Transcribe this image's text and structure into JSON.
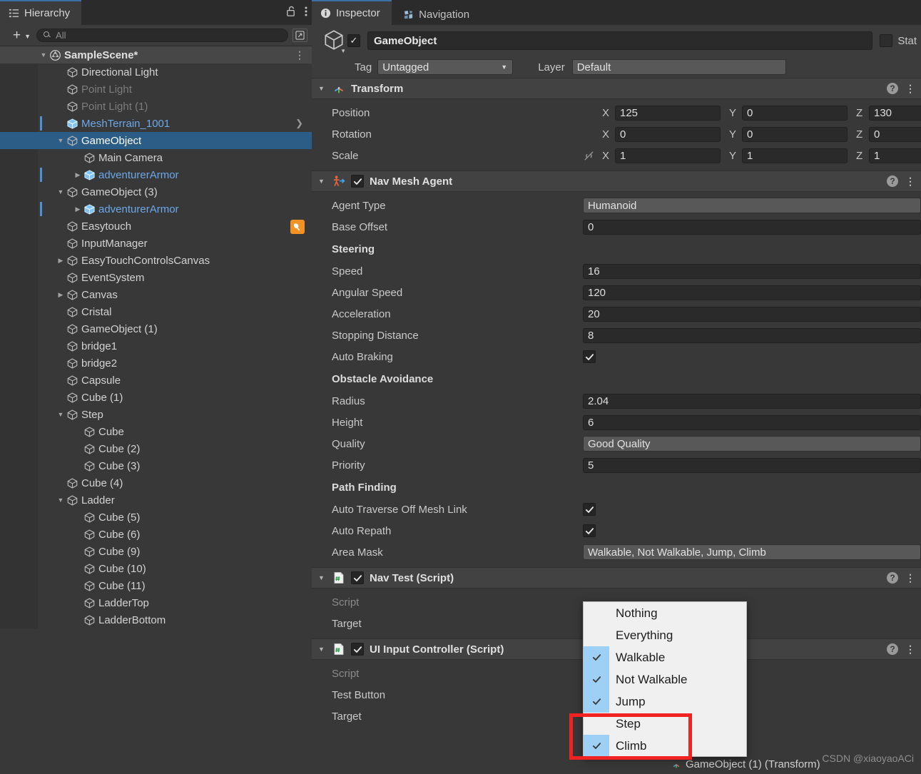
{
  "hierarchy": {
    "tab_label": "Hierarchy",
    "tab_icon": "hierarchy-icon",
    "lock_icon": "lock-open-icon",
    "menu_icon": "kebab-menu-icon",
    "add_label": "+",
    "search_placeholder": "All",
    "search_value": "",
    "expand_icon": "expand-window-icon",
    "items": [
      {
        "label": "SampleScene*",
        "depth": 0,
        "arrow": "down",
        "icon": "unity-scene-icon",
        "style": "scene",
        "menu": true
      },
      {
        "label": "Directional Light",
        "depth": 1,
        "arrow": "none",
        "icon": "gameobject-cube-icon",
        "style": "normal"
      },
      {
        "label": "Point Light",
        "depth": 1,
        "arrow": "none",
        "icon": "gameobject-cube-icon",
        "style": "dim"
      },
      {
        "label": "Point Light (1)",
        "depth": 1,
        "arrow": "none",
        "icon": "gameobject-cube-icon",
        "style": "dim"
      },
      {
        "label": "MeshTerrain_1001",
        "depth": 1,
        "arrow": "none",
        "icon": "prefab-cube-icon",
        "style": "prefab",
        "prefab_bar": true,
        "chevron_right": true
      },
      {
        "label": "GameObject",
        "depth": 1,
        "arrow": "down",
        "icon": "gameobject-cube-icon",
        "style": "selected"
      },
      {
        "label": "Main Camera",
        "depth": 2,
        "arrow": "none",
        "icon": "gameobject-cube-icon",
        "style": "normal"
      },
      {
        "label": "adventurerArmor",
        "depth": 2,
        "arrow": "right",
        "icon": "prefab-cube-icon",
        "style": "prefab",
        "prefab_bar": true
      },
      {
        "label": "GameObject (3)",
        "depth": 1,
        "arrow": "down",
        "icon": "gameobject-cube-icon",
        "style": "normal"
      },
      {
        "label": "adventurerArmor",
        "depth": 2,
        "arrow": "right",
        "icon": "prefab-cube-icon",
        "style": "prefab",
        "prefab_bar": true
      },
      {
        "label": "Easytouch",
        "depth": 1,
        "arrow": "none",
        "icon": "gameobject-cube-icon",
        "style": "normal",
        "badge": "easytouch-orange-icon"
      },
      {
        "label": "InputManager",
        "depth": 1,
        "arrow": "none",
        "icon": "gameobject-cube-icon",
        "style": "normal"
      },
      {
        "label": "EasyTouchControlsCanvas",
        "depth": 1,
        "arrow": "right",
        "icon": "gameobject-cube-icon",
        "style": "normal"
      },
      {
        "label": "EventSystem",
        "depth": 1,
        "arrow": "none",
        "icon": "gameobject-cube-icon",
        "style": "normal"
      },
      {
        "label": "Canvas",
        "depth": 1,
        "arrow": "right",
        "icon": "gameobject-cube-icon",
        "style": "normal"
      },
      {
        "label": "Cristal",
        "depth": 1,
        "arrow": "none",
        "icon": "gameobject-cube-icon",
        "style": "normal"
      },
      {
        "label": "GameObject (1)",
        "depth": 1,
        "arrow": "none",
        "icon": "gameobject-cube-icon",
        "style": "normal"
      },
      {
        "label": "bridge1",
        "depth": 1,
        "arrow": "none",
        "icon": "gameobject-cube-icon",
        "style": "normal"
      },
      {
        "label": "bridge2",
        "depth": 1,
        "arrow": "none",
        "icon": "gameobject-cube-icon",
        "style": "normal"
      },
      {
        "label": "Capsule",
        "depth": 1,
        "arrow": "none",
        "icon": "gameobject-cube-icon",
        "style": "normal"
      },
      {
        "label": "Cube (1)",
        "depth": 1,
        "arrow": "none",
        "icon": "gameobject-cube-icon",
        "style": "normal"
      },
      {
        "label": "Step",
        "depth": 1,
        "arrow": "down",
        "icon": "gameobject-cube-icon",
        "style": "normal"
      },
      {
        "label": "Cube",
        "depth": 2,
        "arrow": "none",
        "icon": "gameobject-cube-icon",
        "style": "normal"
      },
      {
        "label": "Cube (2)",
        "depth": 2,
        "arrow": "none",
        "icon": "gameobject-cube-icon",
        "style": "normal"
      },
      {
        "label": "Cube (3)",
        "depth": 2,
        "arrow": "none",
        "icon": "gameobject-cube-icon",
        "style": "normal"
      },
      {
        "label": "Cube (4)",
        "depth": 1,
        "arrow": "none",
        "icon": "gameobject-cube-icon",
        "style": "normal"
      },
      {
        "label": "Ladder",
        "depth": 1,
        "arrow": "down",
        "icon": "gameobject-cube-icon",
        "style": "normal"
      },
      {
        "label": "Cube (5)",
        "depth": 2,
        "arrow": "none",
        "icon": "gameobject-cube-icon",
        "style": "normal"
      },
      {
        "label": "Cube (6)",
        "depth": 2,
        "arrow": "none",
        "icon": "gameobject-cube-icon",
        "style": "normal"
      },
      {
        "label": "Cube (9)",
        "depth": 2,
        "arrow": "none",
        "icon": "gameobject-cube-icon",
        "style": "normal"
      },
      {
        "label": "Cube (10)",
        "depth": 2,
        "arrow": "none",
        "icon": "gameobject-cube-icon",
        "style": "normal"
      },
      {
        "label": "Cube (11)",
        "depth": 2,
        "arrow": "none",
        "icon": "gameobject-cube-icon",
        "style": "normal"
      },
      {
        "label": "LadderTop",
        "depth": 2,
        "arrow": "none",
        "icon": "gameobject-cube-icon",
        "style": "normal"
      },
      {
        "label": "LadderBottom",
        "depth": 2,
        "arrow": "none",
        "icon": "gameobject-cube-icon",
        "style": "normal"
      }
    ]
  },
  "inspector": {
    "tabs": [
      {
        "label": "Inspector",
        "icon": "info-circle-icon",
        "active": true
      },
      {
        "label": "Navigation",
        "icon": "navigation-mesh-icon",
        "active": false
      }
    ],
    "object": {
      "icon": "gameobject-cube-icon",
      "enabled_checked": "✓",
      "name": "GameObject",
      "static_label": "Stat",
      "static_checked": false,
      "tag_label": "Tag",
      "tag_value": "Untagged",
      "layer_label": "Layer",
      "layer_value": "Default"
    },
    "components": [
      {
        "name": "Transform",
        "icon": "transform-axis-icon",
        "has_enable_toggle": false,
        "rows": [
          {
            "label": "Position",
            "type": "vector3",
            "x": "125",
            "y": "0",
            "z": "130"
          },
          {
            "label": "Rotation",
            "type": "vector3",
            "x": "0",
            "y": "0",
            "z": "0"
          },
          {
            "label": "Scale",
            "type": "vector3",
            "x": "1",
            "y": "1",
            "z": "1",
            "link_icon": "constrain-proportions-off-icon"
          }
        ]
      },
      {
        "name": "Nav Mesh Agent",
        "icon": "navmesh-agent-icon",
        "has_enable_toggle": true,
        "enabled_checked": "✓",
        "rows": [
          {
            "label": "Agent Type",
            "type": "popup",
            "value": "Humanoid"
          },
          {
            "label": "Base Offset",
            "type": "text",
            "value": "0"
          },
          {
            "label": "Steering",
            "type": "header"
          },
          {
            "label": "Speed",
            "type": "text",
            "value": "16"
          },
          {
            "label": "Angular Speed",
            "type": "text",
            "value": "120"
          },
          {
            "label": "Acceleration",
            "type": "text",
            "value": "20"
          },
          {
            "label": "Stopping Distance",
            "type": "text",
            "value": "8"
          },
          {
            "label": "Auto Braking",
            "type": "check",
            "checked": true
          },
          {
            "label": "Obstacle Avoidance",
            "type": "header"
          },
          {
            "label": "Radius",
            "type": "text",
            "value": "2.04"
          },
          {
            "label": "Height",
            "type": "text",
            "value": "6"
          },
          {
            "label": "Quality",
            "type": "popup",
            "value": "Good Quality"
          },
          {
            "label": "Priority",
            "type": "text",
            "value": "5"
          },
          {
            "label": "Path Finding",
            "type": "header"
          },
          {
            "label": "Auto Traverse Off Mesh Link",
            "type": "check",
            "checked": true
          },
          {
            "label": "Auto Repath",
            "type": "check",
            "checked": true
          },
          {
            "label": "Area Mask",
            "type": "popup",
            "value": "Walkable, Not Walkable, Jump, Climb"
          }
        ]
      },
      {
        "name": "Nav Test (Script)",
        "icon": "cs-script-icon",
        "has_enable_toggle": true,
        "enabled_checked": "✓",
        "rows": [
          {
            "label": "Script",
            "type": "objectfield",
            "value": "",
            "dimmed": true
          },
          {
            "label": "Target",
            "type": "objectfield",
            "value": ""
          }
        ]
      },
      {
        "name": "UI Input Controller (Script)",
        "icon": "cs-script-icon",
        "has_enable_toggle": true,
        "enabled_checked": "✓",
        "rows": [
          {
            "label": "Script",
            "type": "objectfield",
            "value": "",
            "dimmed": true
          },
          {
            "label": "Test Button",
            "type": "objectfield",
            "value": ""
          },
          {
            "label": "Target",
            "type": "objectfield",
            "value": ""
          }
        ]
      }
    ],
    "behind_dropdown_text": {
      "paren": ")",
      "transform_ref": "GameObject (1) (Transform)"
    }
  },
  "area_mask_dropdown": {
    "title": "area-mask-options",
    "items": [
      {
        "label": "Nothing",
        "checked": false
      },
      {
        "label": "Everything",
        "checked": false
      },
      {
        "label": "Walkable",
        "checked": true
      },
      {
        "label": "Not Walkable",
        "checked": true
      },
      {
        "label": "Jump",
        "checked": true
      },
      {
        "label": "Step",
        "checked": false
      },
      {
        "label": "Climb",
        "checked": true
      }
    ],
    "highlight_color": "#f02222",
    "check_bg_color": "#9ed0f5"
  },
  "watermark": {
    "text": "CSDN @xiaoyaoACi"
  }
}
